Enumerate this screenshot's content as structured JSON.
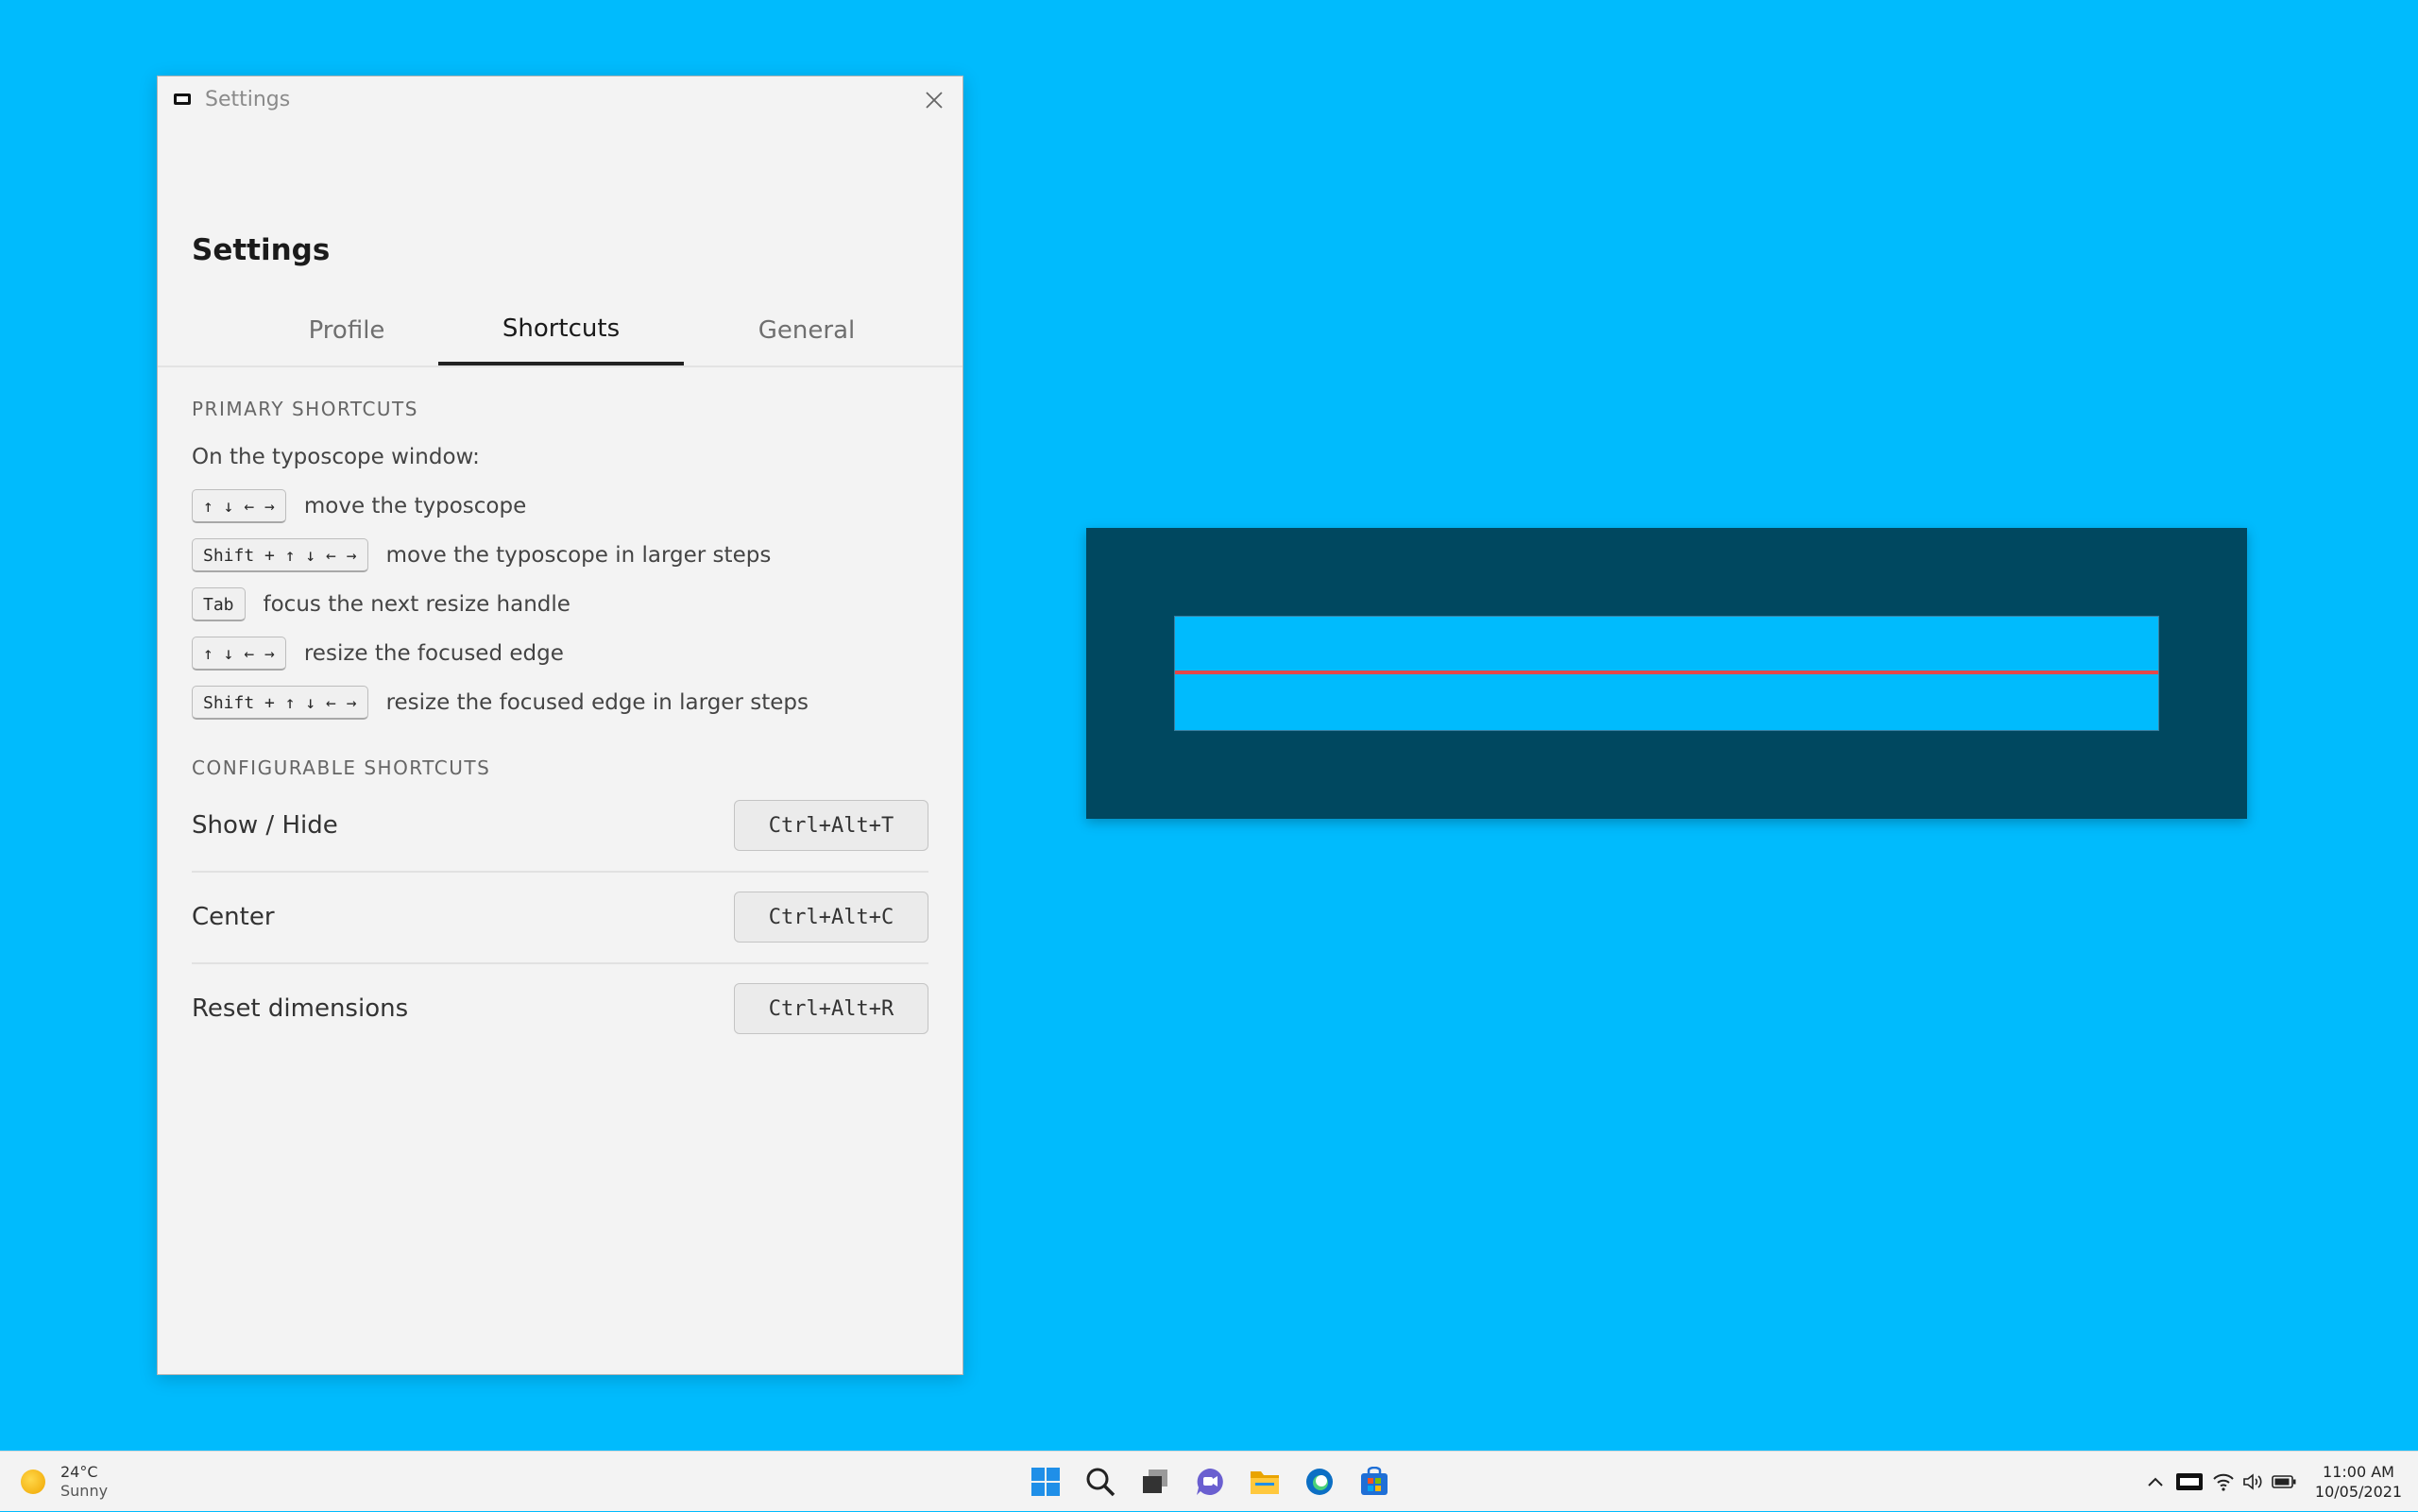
{
  "window": {
    "title": "Settings",
    "heading": "Settings",
    "tabs": [
      {
        "label": "Profile",
        "active": false
      },
      {
        "label": "Shortcuts",
        "active": true
      },
      {
        "label": "General",
        "active": false
      }
    ]
  },
  "primary": {
    "section_title": "PRIMARY SHORTCUTS",
    "intro": "On the typoscope window:",
    "items": [
      {
        "keys": "↑ ↓ ← →",
        "description": "move the typoscope"
      },
      {
        "keys": "Shift + ↑ ↓ ← →",
        "description": "move the typoscope in larger steps"
      },
      {
        "keys": "Tab",
        "description": "focus the next resize handle"
      },
      {
        "keys": "↑ ↓ ← →",
        "description": "resize the focused edge"
      },
      {
        "keys": "Shift + ↑ ↓ ← →",
        "description": "resize the focused edge in larger steps"
      }
    ]
  },
  "configurable": {
    "section_title": "CONFIGURABLE SHORTCUTS",
    "items": [
      {
        "label": "Show / Hide",
        "shortcut": "Ctrl+Alt+T"
      },
      {
        "label": "Center",
        "shortcut": "Ctrl+Alt+C"
      },
      {
        "label": "Reset dimensions",
        "shortcut": "Ctrl+Alt+R"
      }
    ]
  },
  "taskbar": {
    "weather_temp": "24°C",
    "weather_condition": "Sunny",
    "time": "11:00 AM",
    "date": "10/05/2021",
    "pinned_icons": [
      "start-icon",
      "search-icon",
      "task-view-icon",
      "chat-icon",
      "file-explorer-icon",
      "edge-icon",
      "store-icon"
    ],
    "tray_icons": [
      "chevron-up-icon",
      "typoscope-tray-icon",
      "wifi-icon",
      "volume-icon",
      "battery-icon"
    ]
  },
  "colors": {
    "desktop": "#00bbfd",
    "scope_frame": "#004860",
    "scope_line": "#e4474a"
  }
}
